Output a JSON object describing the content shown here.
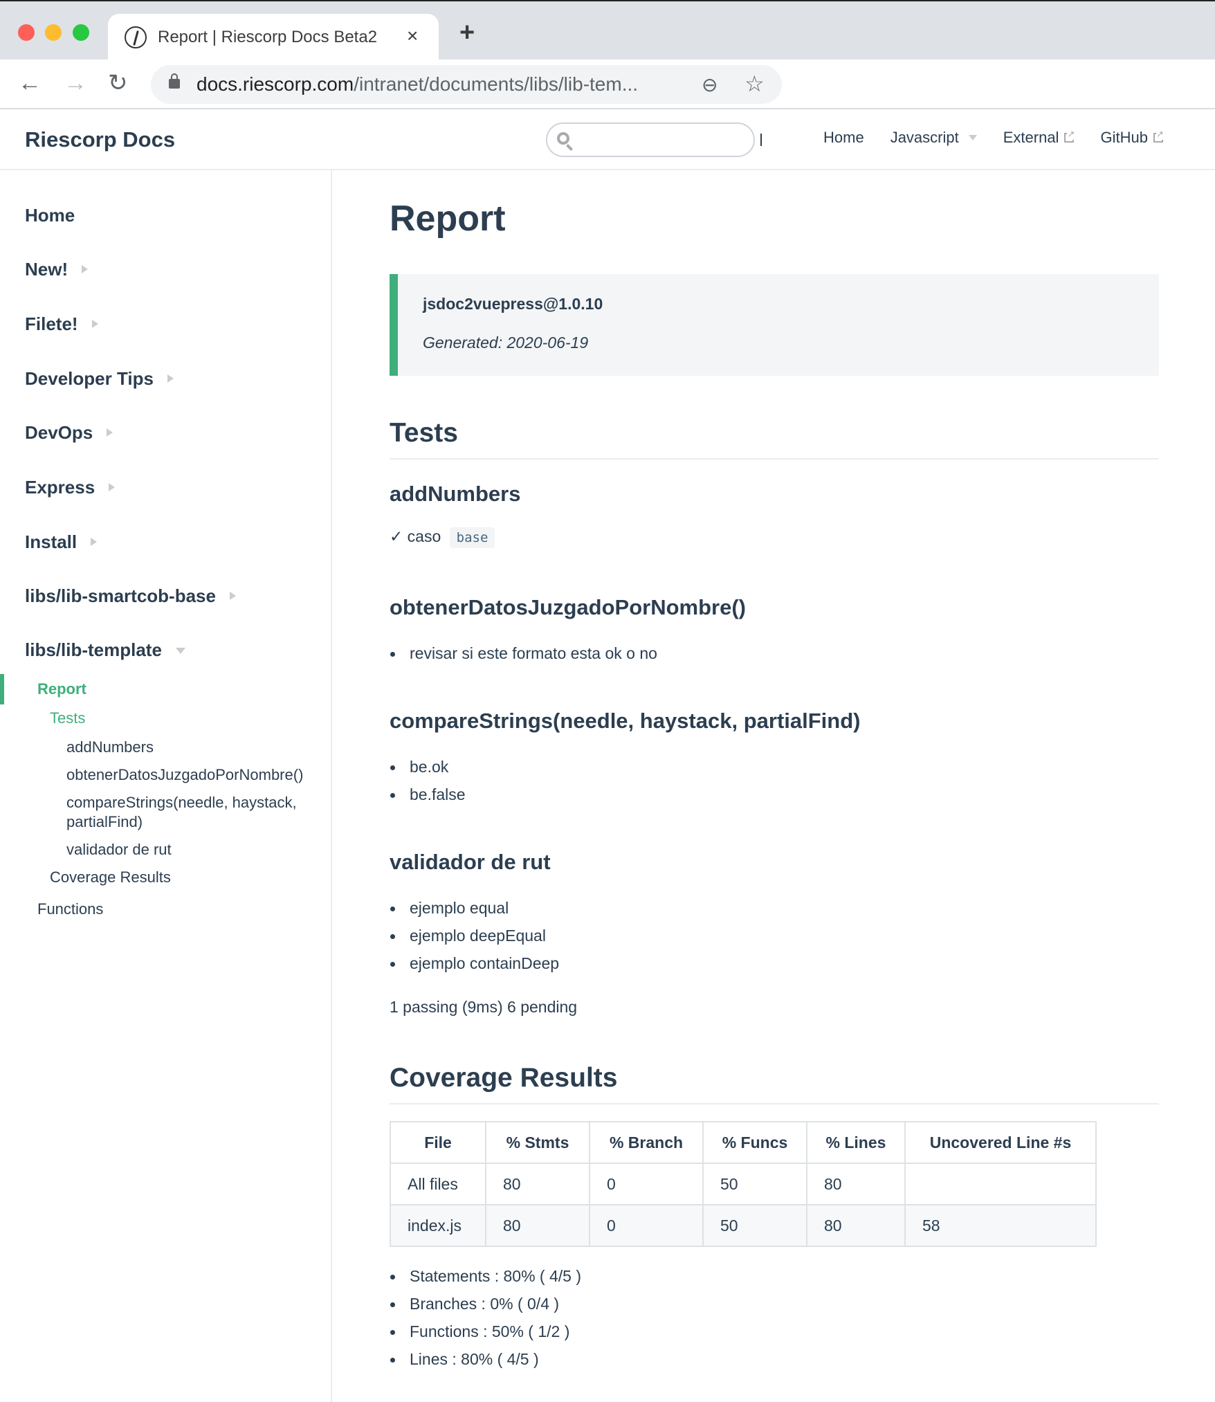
{
  "browser": {
    "tab_title": "Report | Riescorp Docs Beta2",
    "tab_close": "×",
    "new_tab": "+",
    "url_host": "docs.riescorp.com",
    "url_path": "/intranet/documents/libs/lib-tem...",
    "back": "←",
    "forward": "→",
    "reload": "↻",
    "zoom_icon": "⊖",
    "star_icon": "☆"
  },
  "header": {
    "site_title": "Riescorp Docs",
    "search_placeholder": "",
    "nav": [
      {
        "label": "Home",
        "type": "link"
      },
      {
        "label": "Javascript",
        "type": "dropdown"
      },
      {
        "label": "External",
        "type": "external"
      },
      {
        "label": "GitHub",
        "type": "external"
      }
    ]
  },
  "sidebar": {
    "groups": [
      {
        "label": "Home",
        "expandable": false
      },
      {
        "label": "New!",
        "expandable": true
      },
      {
        "label": "Filete!",
        "expandable": true
      },
      {
        "label": "Developer Tips",
        "expandable": true
      },
      {
        "label": "DevOps",
        "expandable": true
      },
      {
        "label": "Express",
        "expandable": true
      },
      {
        "label": "Install",
        "expandable": true
      },
      {
        "label": "libs/lib-smartcob-base",
        "expandable": true
      },
      {
        "label": "libs/lib-template",
        "expandable": true,
        "expanded": true
      }
    ],
    "children": {
      "report": "Report",
      "tests": "Tests",
      "test_items": [
        "addNumbers",
        "obtenerDatosJuzgadoPorNombre()",
        "compareStrings(needle, haystack,",
        "partialFind)",
        "validador de rut"
      ],
      "coverage": "Coverage Results",
      "functions": "Functions"
    },
    "accent_color": "#3eaf7c"
  },
  "main": {
    "title": "Report",
    "tip": {
      "package": "jsdoc2vuepress@1.0.10",
      "generated": "Generated: 2020-06-19"
    },
    "tests": {
      "heading": "Tests",
      "add_numbers": {
        "heading": "addNumbers",
        "check": "✓",
        "case": "caso",
        "code": "base"
      },
      "obtener": {
        "heading": "obtenerDatosJuzgadoPorNombre()",
        "items": [
          "revisar si este formato esta ok o no"
        ]
      },
      "compare": {
        "heading": "compareStrings(needle, haystack, partialFind)",
        "items": [
          "be.ok",
          "be.false"
        ]
      },
      "validador": {
        "heading": "validador de rut",
        "items": [
          "ejemplo equal",
          "ejemplo deepEqual",
          "ejemplo containDeep"
        ]
      },
      "summary": "1 passing (9ms) 6 pending"
    },
    "coverage": {
      "heading": "Coverage Results",
      "columns": [
        "File",
        "% Stmts",
        "% Branch",
        "% Funcs",
        "% Lines",
        "Uncovered Line #s"
      ],
      "rows": [
        [
          "All files",
          "80",
          "0",
          "50",
          "80",
          ""
        ],
        [
          "index.js",
          "80",
          "0",
          "50",
          "80",
          "58"
        ]
      ],
      "summary": [
        "Statements : 80% ( 4/5 )",
        "Branches : 0% ( 0/4 )",
        "Functions : 50% ( 1/2 )",
        "Lines : 80% ( 4/5 )"
      ]
    }
  }
}
